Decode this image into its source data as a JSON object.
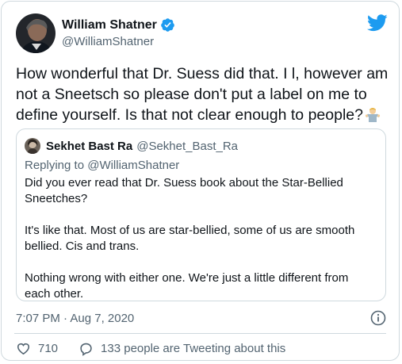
{
  "author": {
    "name": "William Shatner",
    "handle": "@WilliamShatner",
    "avatar_icon": "avatar-photo",
    "verified_icon": "verified-badge-icon"
  },
  "tweet": {
    "text": "How wonderful that Dr. Suess did that. I l, however am not a Sneetsch so please don't put a label on me to define yourself. Is that not clear enough to people?",
    "emoji_icon": "man-shrugging-emoji"
  },
  "quoted_tweet": {
    "name": "Sekhet Bast Ra",
    "handle": "@Sekhet_Bast_Ra",
    "replying_to": "Replying to @WilliamShatner",
    "paragraphs": [
      "Did you ever read that Dr. Suess book about the Star-Bellied Sneetches?",
      "It's like that. Most of us are star-bellied, some of us are smooth bellied. Cis and trans.",
      "Nothing wrong with either one. We're just a little different from each other."
    ]
  },
  "meta": {
    "timestamp": "7:07 PM · Aug 7, 2020"
  },
  "actions": {
    "likes": "710",
    "retweets_text": "133 people are Tweeting about this"
  },
  "colors": {
    "twitter_blue": "#1d9bf0",
    "text_primary": "#0f1419",
    "text_secondary": "#536471",
    "border": "#cfd9de"
  }
}
